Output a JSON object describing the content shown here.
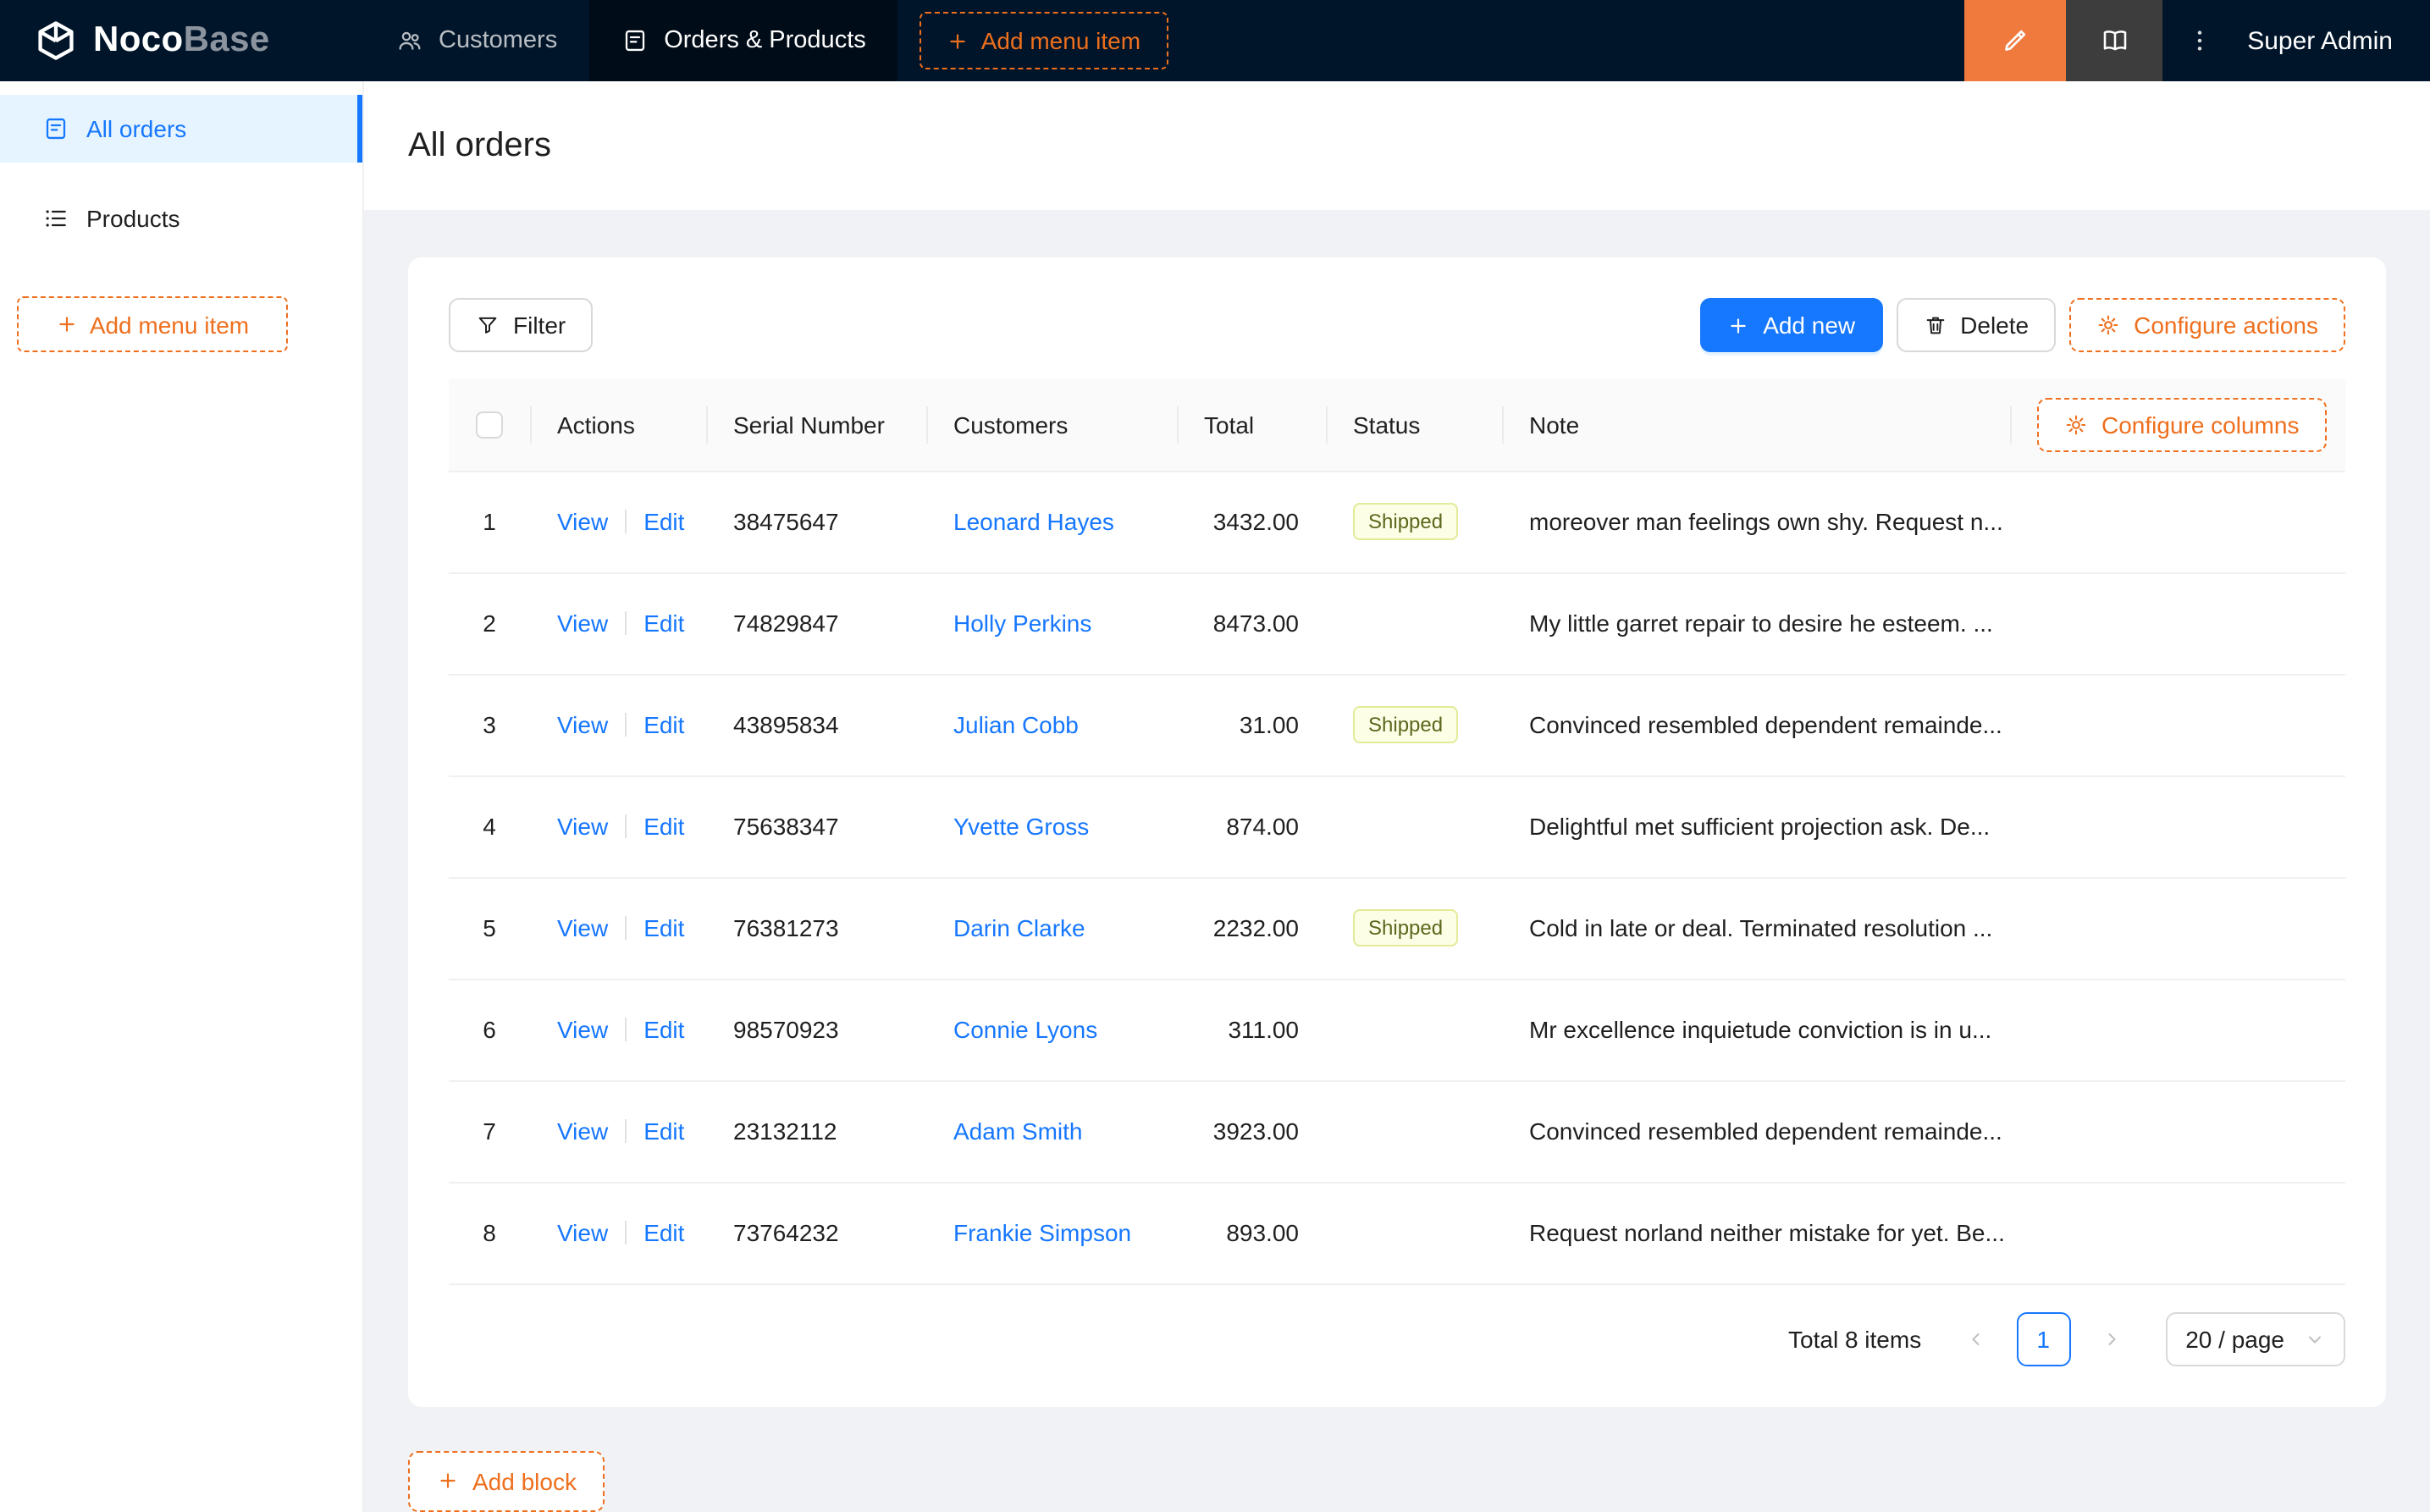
{
  "navbar": {
    "logo": {
      "bold": "Noco",
      "light": "Base"
    },
    "items": [
      {
        "label": "Customers",
        "active": false
      },
      {
        "label": "Orders & Products",
        "active": true
      }
    ],
    "add_menu_item": "Add menu item",
    "user": "Super Admin"
  },
  "sidebar": {
    "items": [
      {
        "label": "All orders",
        "active": true
      },
      {
        "label": "Products",
        "active": false
      }
    ],
    "add_menu_item": "Add menu item"
  },
  "page": {
    "title": "All orders"
  },
  "toolbar": {
    "filter": "Filter",
    "add_new": "Add new",
    "delete": "Delete",
    "configure_actions": "Configure actions"
  },
  "table": {
    "columns": [
      "Actions",
      "Serial Number",
      "Customers",
      "Total",
      "Status",
      "Note"
    ],
    "configure_columns": "Configure columns",
    "actions": {
      "view": "View",
      "edit": "Edit"
    },
    "rows": [
      {
        "index": 1,
        "serial": "38475647",
        "customer": "Leonard Hayes",
        "total": "3432.00",
        "status": "Shipped",
        "note": "moreover man feelings own shy. Request n..."
      },
      {
        "index": 2,
        "serial": "74829847",
        "customer": "Holly Perkins",
        "total": "8473.00",
        "status": "",
        "note": "My little garret repair to desire he esteem. ..."
      },
      {
        "index": 3,
        "serial": "43895834",
        "customer": "Julian Cobb",
        "total": "31.00",
        "status": "Shipped",
        "note": "Convinced resembled dependent remainde..."
      },
      {
        "index": 4,
        "serial": "75638347",
        "customer": "Yvette Gross",
        "total": "874.00",
        "status": "",
        "note": "Delightful met sufficient projection ask. De..."
      },
      {
        "index": 5,
        "serial": "76381273",
        "customer": "Darin Clarke",
        "total": "2232.00",
        "status": "Shipped",
        "note": "Cold in late or deal. Terminated resolution ..."
      },
      {
        "index": 6,
        "serial": "98570923",
        "customer": "Connie Lyons",
        "total": "311.00",
        "status": "",
        "note": "Mr excellence inquietude conviction is in u..."
      },
      {
        "index": 7,
        "serial": "23132112",
        "customer": "Adam Smith",
        "total": "3923.00",
        "status": "",
        "note": "Convinced resembled dependent remainde..."
      },
      {
        "index": 8,
        "serial": "73764232",
        "customer": "Frankie Simpson",
        "total": "893.00",
        "status": "",
        "note": "Request norland neither mistake for yet. Be..."
      }
    ]
  },
  "pagination": {
    "total": "Total 8 items",
    "page": "1",
    "page_size": "20 / page"
  },
  "footer": {
    "add_block": "Add block"
  },
  "colors": {
    "navbar_bg": "#001529",
    "accent_orange": "#ee6f1d",
    "designer_button_orange": "#f07a3e",
    "primary_blue": "#1677ff",
    "selected_menu_bg": "#e6f4ff",
    "status_shipped_bg": "#fcffe6",
    "status_shipped_border": "#e3ea98"
  },
  "icons": {
    "logo": "cube-icon",
    "customers": "people-icon",
    "orders_products": "document-icon",
    "add": "plus-icon",
    "designer": "highlighter-icon",
    "secondary_square": "book-icon",
    "more": "ellipsis-icon",
    "all_orders": "document-icon",
    "products": "list-icon",
    "filter": "funnel-icon",
    "delete": "trash-icon",
    "configure": "gear-icon",
    "prev": "chevron-left-icon",
    "next": "chevron-right-icon",
    "page_size": "chevron-down-icon"
  }
}
